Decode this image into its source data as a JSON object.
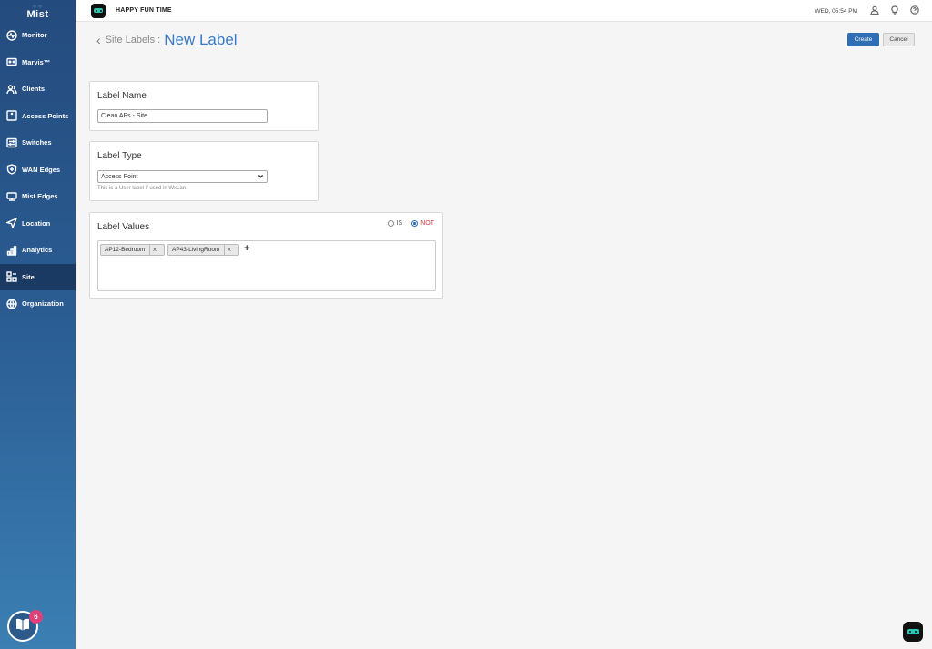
{
  "sidebar": {
    "logo_text": "Mist",
    "items": [
      {
        "label": "Monitor",
        "icon": "monitor-icon"
      },
      {
        "label": "Marvis™",
        "icon": "marvis-icon"
      },
      {
        "label": "Clients",
        "icon": "clients-icon"
      },
      {
        "label": "Access Points",
        "icon": "access-point-icon"
      },
      {
        "label": "Switches",
        "icon": "switch-icon"
      },
      {
        "label": "WAN Edges",
        "icon": "shield-icon"
      },
      {
        "label": "Mist Edges",
        "icon": "server-icon"
      },
      {
        "label": "Location",
        "icon": "location-icon"
      },
      {
        "label": "Analytics",
        "icon": "analytics-icon"
      },
      {
        "label": "Site",
        "icon": "site-icon"
      },
      {
        "label": "Organization",
        "icon": "globe-icon"
      }
    ],
    "active": "Site",
    "notification_count": "6"
  },
  "header": {
    "org_name": "HAPPY FUN TIME",
    "time": "WED, 05:54 PM"
  },
  "page": {
    "breadcrumb": "Site Labels :",
    "title": "New Label",
    "create_label": "Create",
    "cancel_label": "Cancel"
  },
  "label_name": {
    "heading": "Label Name",
    "value": "Clean APs - Site"
  },
  "label_type": {
    "heading": "Label Type",
    "selected": "Access Point",
    "hint": "This is a User label if used in WxLan"
  },
  "label_values": {
    "heading": "Label Values",
    "radio_is": "IS",
    "radio_not": "NOT",
    "selected_radio": "NOT",
    "tags": [
      "AP12-Bedroom",
      "AP43-LivingRoom"
    ],
    "add_symbol": "+",
    "remove_symbol": "×"
  },
  "colors": {
    "accent": "#2f6db5",
    "title_blue": "#3a7cc9",
    "not_red": "#d23b3b"
  }
}
